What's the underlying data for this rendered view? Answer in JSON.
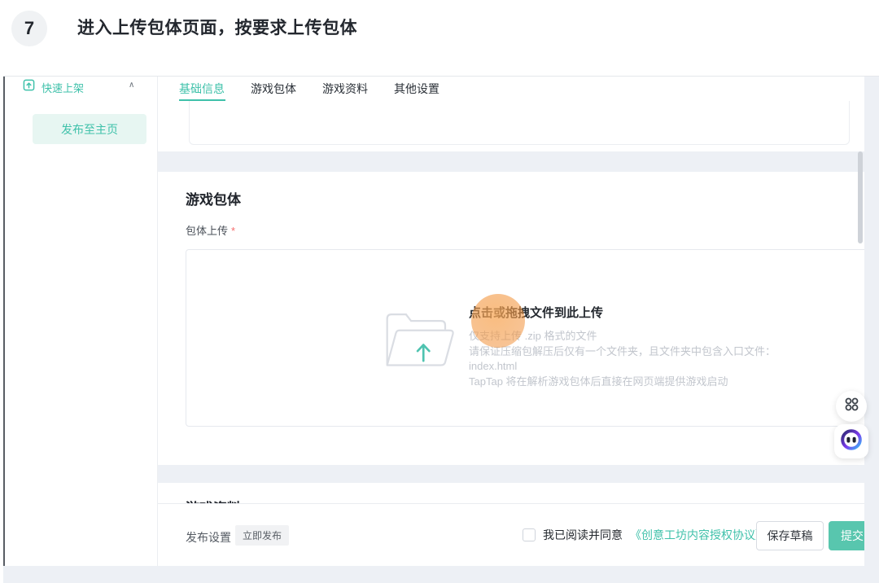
{
  "step": {
    "number": "7",
    "title": "进入上传包体页面，按要求上传包体"
  },
  "sidebar": {
    "group": {
      "label": "快速上架",
      "icon": "quick-launch-icon",
      "collapse_glyph": "∧"
    },
    "active_item": {
      "label": "发布至主页"
    }
  },
  "tabs": {
    "items": [
      {
        "label": "基础信息",
        "active": true
      },
      {
        "label": "游戏包体",
        "active": false
      },
      {
        "label": "游戏资料",
        "active": false
      },
      {
        "label": "其他设置",
        "active": false
      }
    ]
  },
  "package_section": {
    "heading": "游戏包体",
    "field_label": "包体上传",
    "required_mark": "*",
    "uploader": {
      "title": "点击或拖拽文件到此上传",
      "hints": [
        "仅支持上传 .zip 格式的文件",
        "请保证压缩包解压后仅有一个文件夹，且文件夹中包含入口文件：",
        "index.html",
        "TapTap 将在解析游戏包体后直接在网页端提供游戏启动"
      ],
      "icon": "open-folder-upload-icon",
      "annotation": "orange-click-highlight"
    }
  },
  "next_section": {
    "heading": "游戏资料"
  },
  "footer": {
    "publish_label": "发布设置",
    "publish_badge": "立即发布",
    "agreement_text": "我已阅读并同意",
    "agreement_link": "《创意工坊内容授权协议》",
    "save_draft": "保存草稿",
    "submit": "提交",
    "checkbox_checked": false
  },
  "floating": {
    "grid_button": "four-dots-grid-icon",
    "assistant_button": "robot-face-icon"
  },
  "colors": {
    "accent": "#3fc1aa",
    "accent_button": "#58c6ae",
    "accent_light_bg": "#e7f6f2",
    "page_bg": "#edf0f5",
    "hint_text": "#c2c6cd",
    "required_red": "#f56c6c",
    "highlight_orange": "rgba(241,146,60,0.6)"
  }
}
